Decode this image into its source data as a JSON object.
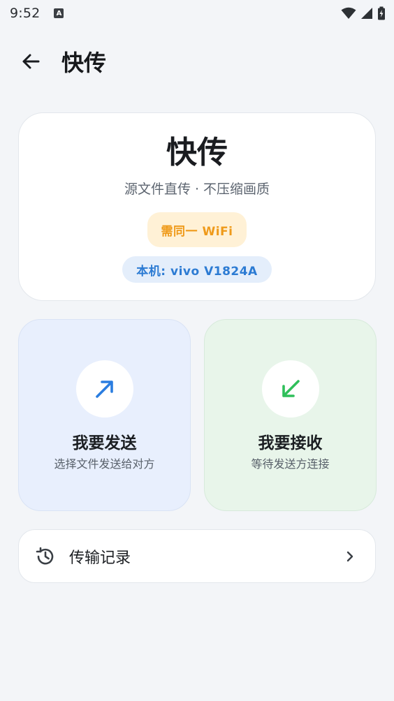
{
  "status_bar": {
    "time": "9:52",
    "notification_letter": "A"
  },
  "app_bar": {
    "title": "快传"
  },
  "hero": {
    "title": "快传",
    "subtitle": "源文件直传 · 不压缩画质",
    "wifi_chip": "需同一 WiFi",
    "device_chip": "本机: vivo V1824A"
  },
  "actions": {
    "send": {
      "title": "我要发送",
      "subtitle": "选择文件发送给对方"
    },
    "receive": {
      "title": "我要接收",
      "subtitle": "等待发送方连接"
    }
  },
  "history": {
    "label": "传输记录"
  },
  "colors": {
    "send_accent": "#2a7de0",
    "receive_accent": "#2fbf5a",
    "wifi_chip_text": "#ef9a1a",
    "device_chip_text": "#2c7bd3"
  },
  "icons": {
    "back": "arrow-left-icon",
    "send": "arrow-up-right-icon",
    "receive": "arrow-down-left-icon",
    "history": "history-icon",
    "chevron": "chevron-right-icon"
  }
}
